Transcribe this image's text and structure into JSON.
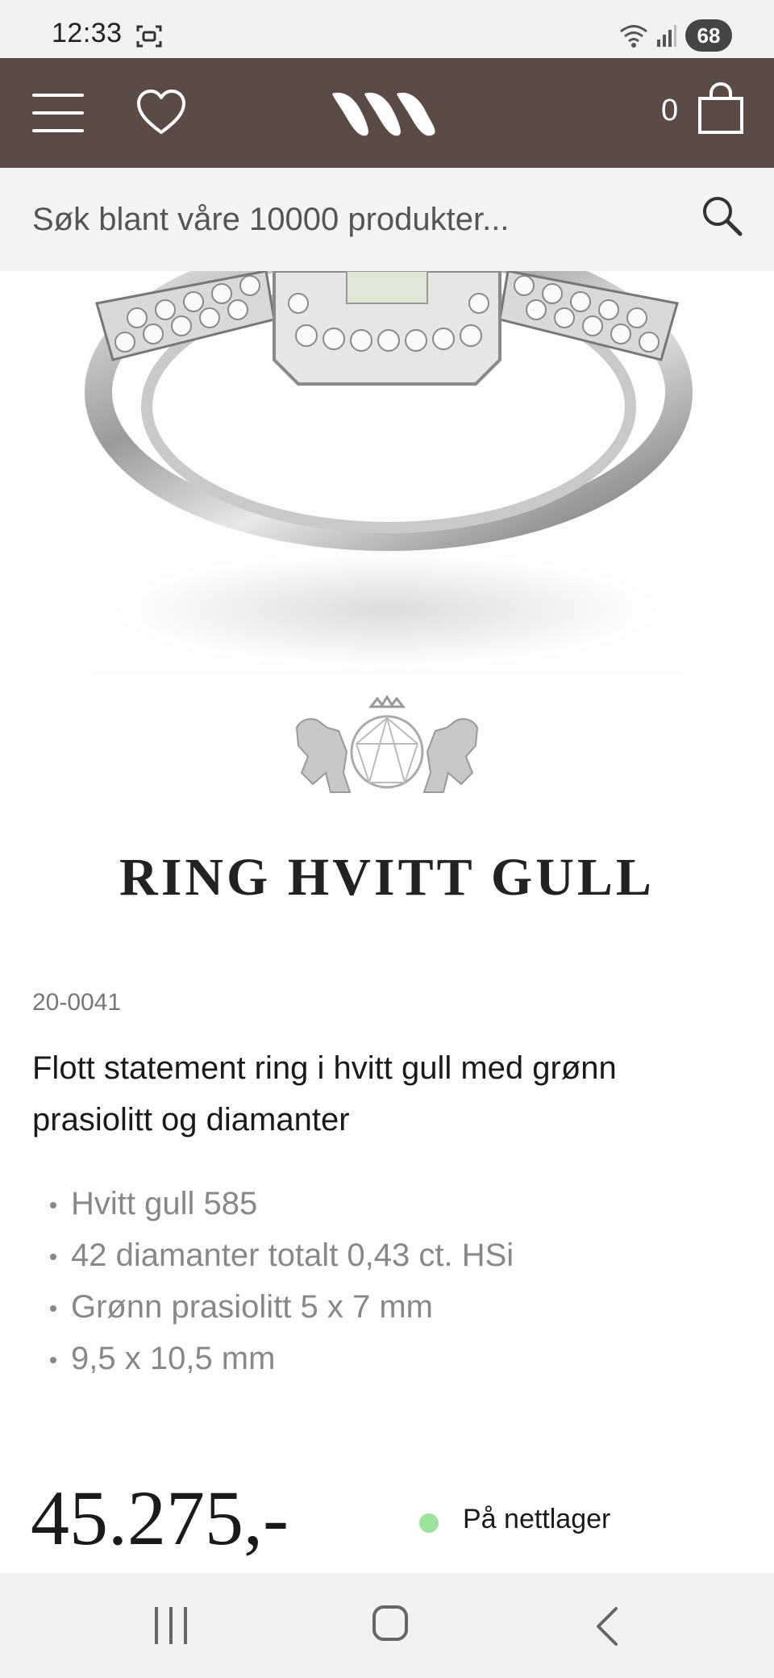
{
  "status_bar": {
    "time": "12:33",
    "battery": "68",
    "icons": [
      "screenshot-icon",
      "wifi-icon",
      "signal-icon"
    ]
  },
  "header": {
    "cart_count": "0",
    "icons": [
      "menu-icon",
      "heart-icon",
      "logo",
      "cart-icon"
    ]
  },
  "search": {
    "placeholder": "Søk blant våre 10000 produkter..."
  },
  "product": {
    "title": "RING HVITT GULL",
    "sku": "20-0041",
    "description": "Flott statement ring i hvitt gull med grønn prasiolitt og diamanter",
    "features": [
      "Hvitt gull 585",
      "42 diamanter totalt 0,43 ct. HSi",
      "Grønn prasiolitt 5 x 7 mm",
      "9,5 x 10,5 mm"
    ],
    "price": "45.275,-",
    "stock_status": "På nettlager",
    "stock_color": "#9be39b"
  },
  "nav_bar": {
    "icons": [
      "recents-icon",
      "home-icon",
      "back-icon"
    ]
  },
  "colors": {
    "header_bg": "#5b4b45",
    "search_bg": "#f4f4f4"
  }
}
